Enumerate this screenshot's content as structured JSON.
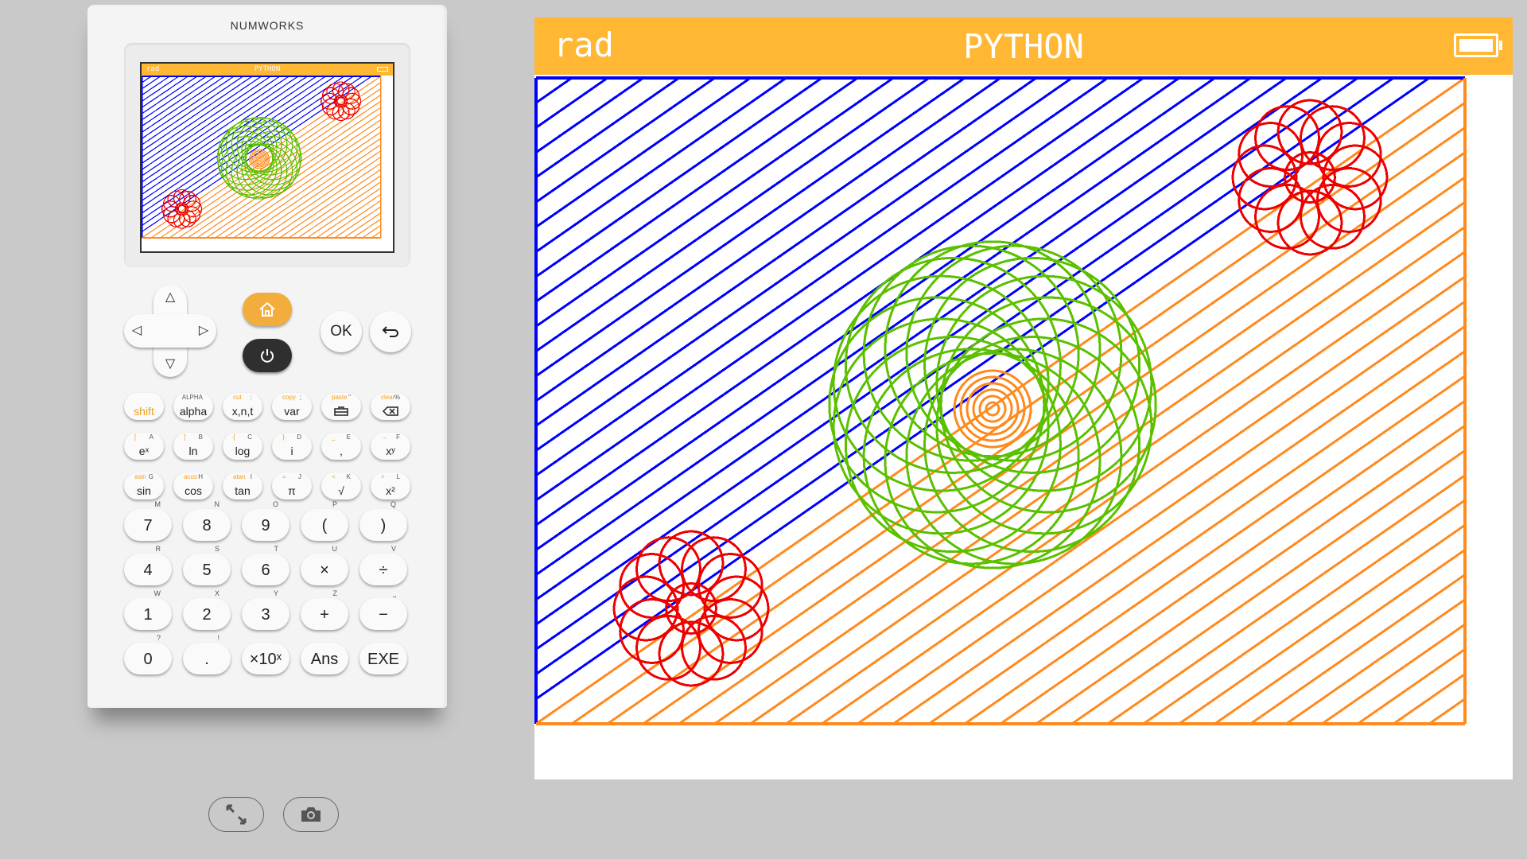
{
  "calculator": {
    "brand": "NUMWORKS",
    "mini_screen": {
      "angle_mode": "rad",
      "app_title": "PYTHON"
    },
    "ok_label": "OK",
    "function_keys": [
      {
        "main": "shift",
        "shifted": "",
        "alpha": ""
      },
      {
        "main": "alpha",
        "shifted": "",
        "alpha": "ALPHA"
      },
      {
        "main": "x,n,t",
        "shifted": "cut",
        "alpha": ":"
      },
      {
        "main": "var",
        "shifted": "copy",
        "alpha": ";"
      },
      {
        "main": "",
        "shifted": "paste",
        "alpha": "\""
      },
      {
        "main": "",
        "shifted": "clear",
        "alpha": "%"
      },
      {
        "main": "eˣ",
        "shifted": "[",
        "alpha": "A"
      },
      {
        "main": "ln",
        "shifted": "]",
        "alpha": "B"
      },
      {
        "main": "log",
        "shifted": "{",
        "alpha": "C"
      },
      {
        "main": "i",
        "shifted": "}",
        "alpha": "D"
      },
      {
        "main": ",",
        "shifted": "_",
        "alpha": "E"
      },
      {
        "main": "xʸ",
        "shifted": "→",
        "alpha": "F"
      },
      {
        "main": "sin",
        "shifted": "asin",
        "alpha": "G"
      },
      {
        "main": "cos",
        "shifted": "acos",
        "alpha": "H"
      },
      {
        "main": "tan",
        "shifted": "atan",
        "alpha": "I"
      },
      {
        "main": "π",
        "shifted": "=",
        "alpha": "J"
      },
      {
        "main": "√",
        "shifted": "<",
        "alpha": "K"
      },
      {
        "main": "x²",
        "shifted": ">",
        "alpha": "L"
      }
    ],
    "number_keys": [
      {
        "main": "7",
        "alpha": "M"
      },
      {
        "main": "8",
        "alpha": "N"
      },
      {
        "main": "9",
        "alpha": "O"
      },
      {
        "main": "(",
        "alpha": "P"
      },
      {
        "main": ")",
        "alpha": "Q"
      },
      {
        "main": "4",
        "alpha": "R"
      },
      {
        "main": "5",
        "alpha": "S"
      },
      {
        "main": "6",
        "alpha": "T"
      },
      {
        "main": "×",
        "alpha": "U"
      },
      {
        "main": "÷",
        "alpha": "V"
      },
      {
        "main": "1",
        "alpha": "W"
      },
      {
        "main": "2",
        "alpha": "X"
      },
      {
        "main": "3",
        "alpha": "Y"
      },
      {
        "main": "+",
        "alpha": "Z"
      },
      {
        "main": "−",
        "alpha": "⎵"
      },
      {
        "main": "0",
        "alpha": "?"
      },
      {
        "main": ".",
        "alpha": "!"
      },
      {
        "main": "×10ˣ",
        "alpha": ""
      },
      {
        "main": "Ans",
        "alpha": ""
      },
      {
        "main": "EXE",
        "alpha": ""
      }
    ]
  },
  "screen": {
    "angle_mode": "rad",
    "app_title": "PYTHON"
  },
  "colors": {
    "header": "#ffb734",
    "blue": "#0000ff",
    "green": "#5bc000",
    "red": "#ee0000",
    "orange": "#ff8a1e"
  },
  "icons": [
    "home-icon",
    "power-icon",
    "backspace-icon",
    "back-icon",
    "fullscreen-icon",
    "camera-icon",
    "battery-icon"
  ]
}
